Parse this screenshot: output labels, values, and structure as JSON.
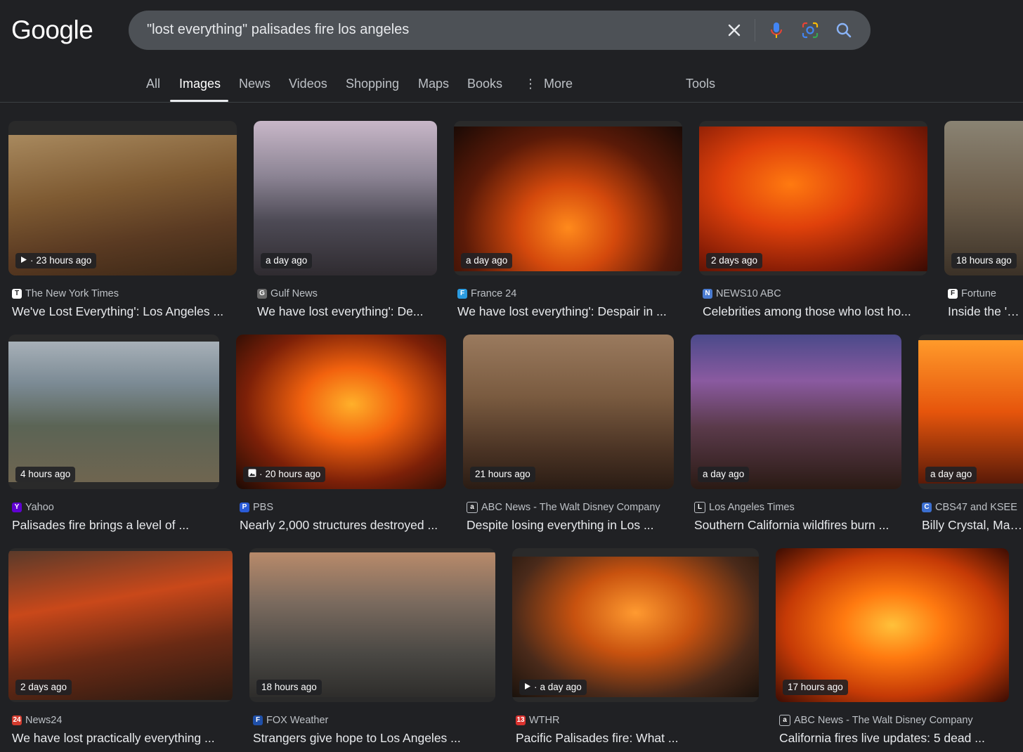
{
  "logo": "Google",
  "search": {
    "query": "\"lost everything\" palisades fire los angeles"
  },
  "icons": {
    "clear": "close-icon",
    "voice": "microphone-icon",
    "lens": "camera-lens-icon",
    "search": "search-icon"
  },
  "tabs": [
    {
      "label": "All"
    },
    {
      "label": "Images",
      "active": true
    },
    {
      "label": "News"
    },
    {
      "label": "Videos"
    },
    {
      "label": "Shopping"
    },
    {
      "label": "Maps"
    },
    {
      "label": "Books"
    },
    {
      "label": "More"
    }
  ],
  "tools_label": "Tools",
  "results": [
    {
      "time": "23 hours ago",
      "media": "video",
      "source": "The New York Times",
      "title": "We've Lost Everything': Los Angeles ...",
      "fav_color": "#ffffff",
      "fav_glyph": "T"
    },
    {
      "time": "a day ago",
      "media": "",
      "source": "Gulf News",
      "title": "We have lost everything': De...",
      "fav_color": "#6b6b6b",
      "fav_glyph": "G"
    },
    {
      "time": "a day ago",
      "media": "",
      "source": "France 24",
      "title": "We have lost everything': Despair in ...",
      "fav_color": "#2b9be0",
      "fav_glyph": "F"
    },
    {
      "time": "2 days ago",
      "media": "",
      "source": "NEWS10 ABC",
      "title": "Celebrities among those who lost ho...",
      "fav_color": "#4a7bd0",
      "fav_glyph": "N"
    },
    {
      "time": "18 hours ago",
      "media": "",
      "source": "Fortune",
      "title": "Inside the 'cha",
      "fav_color": "#ffffff",
      "fav_glyph": "F"
    },
    {
      "time": "4 hours ago",
      "media": "",
      "source": "Yahoo",
      "title": "Palisades fire brings a level of ...",
      "fav_color": "#6001d2",
      "fav_glyph": "Y"
    },
    {
      "time": "20 hours ago",
      "media": "image",
      "source": "PBS",
      "title": "Nearly 2,000 structures destroyed ...",
      "fav_color": "#2a5bd7",
      "fav_glyph": "P"
    },
    {
      "time": "21 hours ago",
      "media": "",
      "source": "ABC News - The Walt Disney Company",
      "title": "Despite losing everything in Los ...",
      "fav_color": "#202124",
      "fav_glyph": "a"
    },
    {
      "time": "a day ago",
      "media": "",
      "source": "Los Angeles Times",
      "title": "Southern California wildfires burn ...",
      "fav_color": "#202124",
      "fav_glyph": "L"
    },
    {
      "time": "a day ago",
      "media": "",
      "source": "CBS47 and KSEE",
      "title": "Billy Crystal, Mand",
      "fav_color": "#3b6fd1",
      "fav_glyph": "C"
    },
    {
      "time": "2 days ago",
      "media": "",
      "source": "News24",
      "title": "We have lost practically everything ...",
      "fav_color": "#d23b2e",
      "fav_glyph": "24"
    },
    {
      "time": "18 hours ago",
      "media": "",
      "source": "FOX Weather",
      "title": "Strangers give hope to Los Angeles ...",
      "fav_color": "#1f4fa8",
      "fav_glyph": "F"
    },
    {
      "time": "a day ago",
      "media": "video",
      "source": "WTHR",
      "title": "Pacific Palisades fire: What ...",
      "fav_color": "#d9322f",
      "fav_glyph": "13"
    },
    {
      "time": "17 hours ago",
      "media": "",
      "source": "ABC News - The Walt Disney Company",
      "title": "California fires live updates: 5 dead ...",
      "fav_color": "#202124",
      "fav_glyph": "a"
    }
  ]
}
